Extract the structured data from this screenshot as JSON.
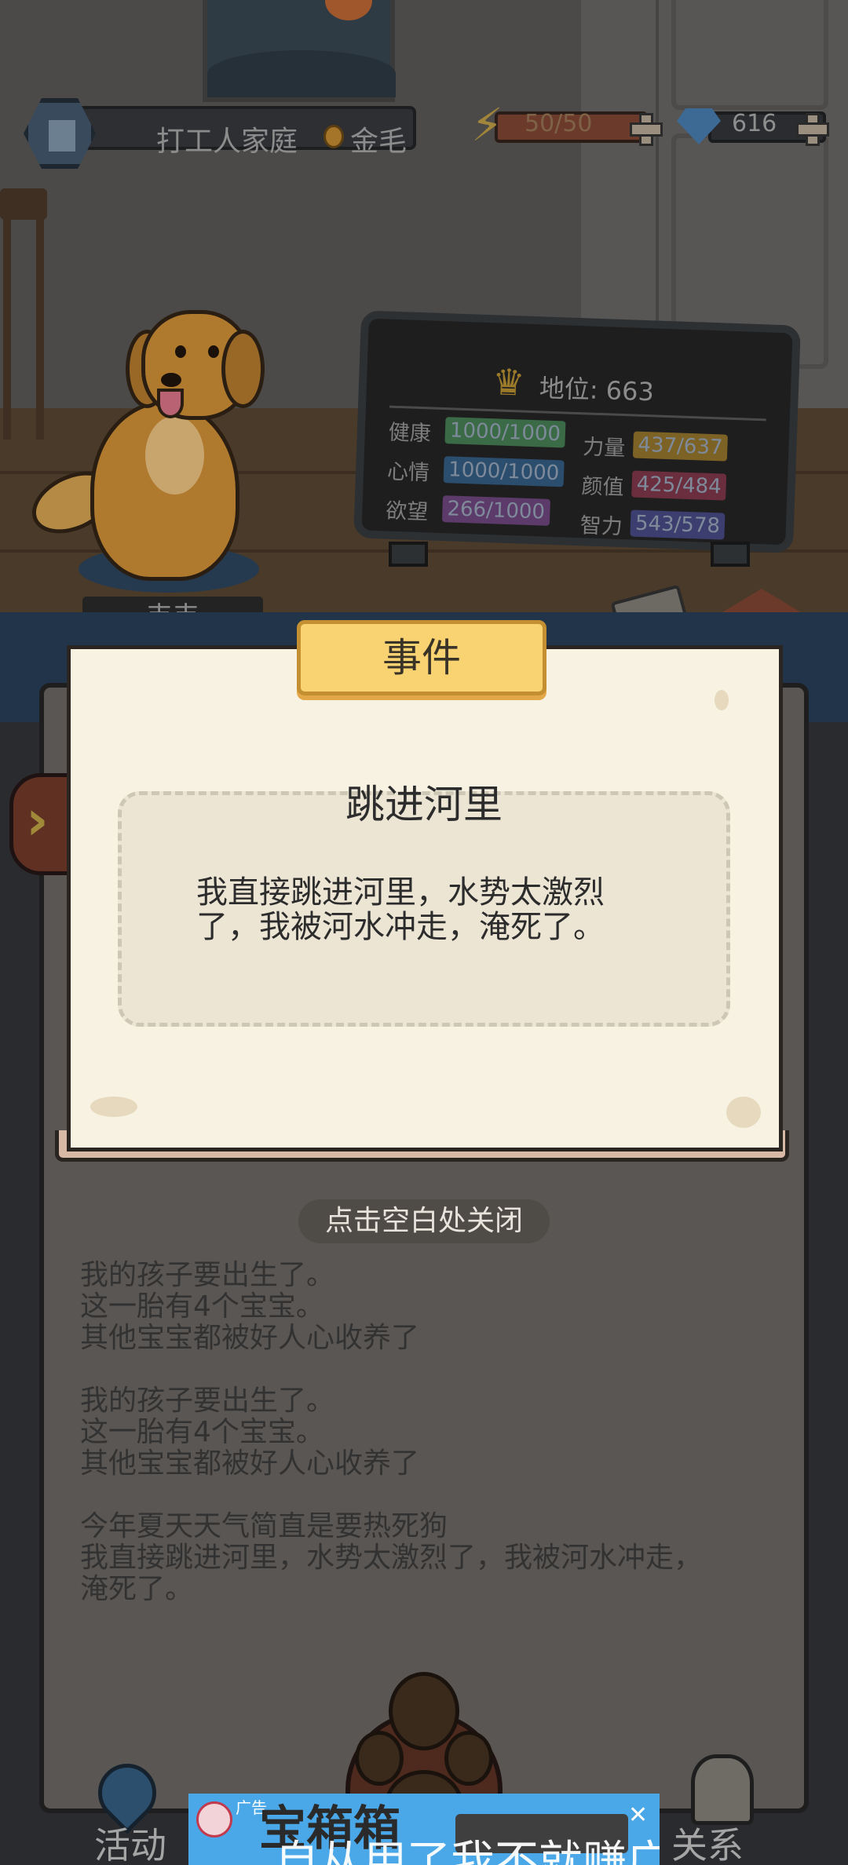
{
  "hud": {
    "family_name": "打工人家庭",
    "breed": "金毛",
    "energy": "50/50",
    "gems": "616"
  },
  "dog": {
    "name": "韦韦"
  },
  "stats": {
    "status_label": "地位: 663",
    "items": [
      {
        "label": "健康",
        "value": "1000/1000",
        "color": "#3b6a46"
      },
      {
        "label": "心情",
        "value": "1000/1000",
        "color": "#2c4e6e"
      },
      {
        "label": "欲望",
        "value": "266/1000",
        "color": "#5c3b6a"
      },
      {
        "label": "力量",
        "value": "437/637",
        "color": "#7c6225"
      },
      {
        "label": "颜值",
        "value": "425/484",
        "color": "#6a2e3e"
      },
      {
        "label": "智力",
        "value": "543/578",
        "color": "#3b3e6e"
      }
    ]
  },
  "event": {
    "ribbon_title": "事件",
    "title": "跳进河里",
    "body_line1": "我直接跳进河里，水势太激烈",
    "body_line2": "了，我被河水冲走，淹死了。"
  },
  "close_hint": "点击空白处关闭",
  "log": {
    "lines": [
      "我的孩子要出生了。",
      "这一胎有4个宝宝。",
      "其他宝宝都被好人心收养了",
      "",
      "我的孩子要出生了。",
      "这一胎有4个宝宝。",
      "其他宝宝都被好人心收养了",
      "",
      "今年夏天天气简直是要热死狗",
      "我直接跳进河里，水势太激烈了，我被河水冲走，",
      "淹死了。"
    ]
  },
  "nav": {
    "activity": "活动",
    "relation": "关系"
  },
  "ad": {
    "tag": "广告",
    "title": "宝箱箱",
    "subtitle": "自从用了我不就赚广告",
    "close": "✕"
  }
}
